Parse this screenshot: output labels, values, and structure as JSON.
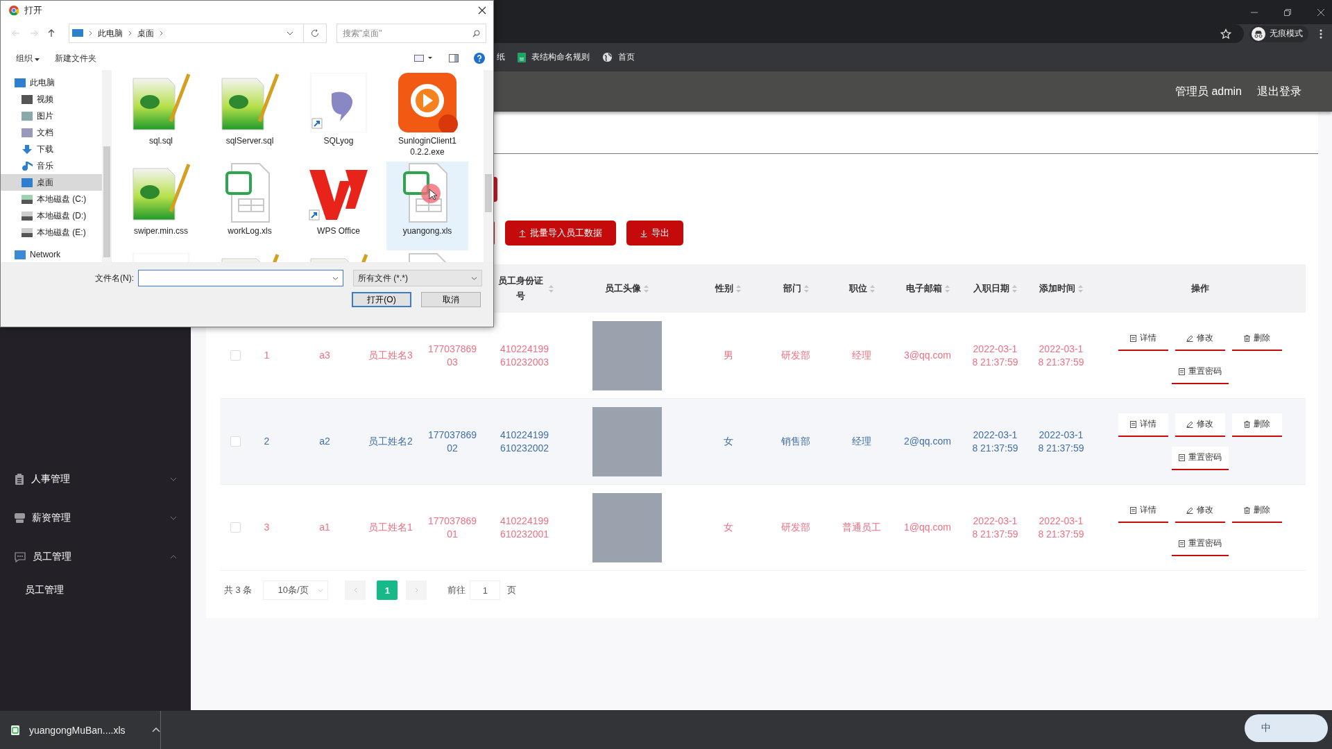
{
  "browser": {
    "bookmarks": [
      {
        "label": "纸",
        "kind": "plain"
      },
      {
        "label": "表结构命名规则",
        "kind": "sheet"
      },
      {
        "label": "首页",
        "kind": "globe"
      }
    ],
    "incognito": "无痕模式"
  },
  "header": {
    "user": "管理员 admin",
    "logout": "退出登录"
  },
  "sidebar": {
    "items": [
      {
        "label": "人事管理",
        "kind": "clipboard",
        "expanded": false
      },
      {
        "label": "薪资管理",
        "kind": "wallet",
        "expanded": false
      },
      {
        "label": "员工管理",
        "kind": "chat",
        "expanded": true,
        "children": [
          {
            "label": "员工管理"
          }
        ]
      }
    ]
  },
  "toolbar": {
    "buttons": [
      {
        "label": "批量导入员工数据",
        "kind": "upload"
      },
      {
        "label": "导出",
        "kind": "download"
      }
    ]
  },
  "table": {
    "columns": [
      {
        "label": "员工身份证号",
        "sortable": true
      },
      {
        "label": "员工头像",
        "sortable": true
      },
      {
        "label": "性别",
        "sortable": true
      },
      {
        "label": "部门",
        "sortable": true
      },
      {
        "label": "职位",
        "sortable": true
      },
      {
        "label": "电子邮箱",
        "sortable": true
      },
      {
        "label": "入职日期",
        "sortable": true
      },
      {
        "label": "添加时间",
        "sortable": true
      },
      {
        "label": "操作",
        "sortable": false
      }
    ],
    "rows": [
      {
        "checked": false,
        "highlighted": false,
        "index": "1",
        "account": "a3",
        "name": "员工姓名3",
        "phone": "17703786903",
        "id_number": "410224199610232003",
        "gender": "男",
        "department": "研发部",
        "position": "经理",
        "email": "3@qq.com",
        "hire_date": "2022-03-18 21:37:59",
        "added_at": "2022-03-18 21:37:59",
        "actions": [
          {
            "label": "详情",
            "kind": "detail"
          },
          {
            "label": "修改",
            "kind": "edit"
          },
          {
            "label": "删除",
            "kind": "delete"
          },
          {
            "label": "重置密码",
            "kind": "reset"
          }
        ]
      },
      {
        "checked": false,
        "highlighted": true,
        "index": "2",
        "account": "a2",
        "name": "员工姓名2",
        "phone": "17703786902",
        "id_number": "410224199610232002",
        "gender": "女",
        "department": "销售部",
        "position": "经理",
        "email": "2@qq.com",
        "hire_date": "2022-03-18 21:37:59",
        "added_at": "2022-03-18 21:37:59",
        "actions": [
          {
            "label": "详情",
            "kind": "detail"
          },
          {
            "label": "修改",
            "kind": "edit"
          },
          {
            "label": "删除",
            "kind": "delete"
          },
          {
            "label": "重置密码",
            "kind": "reset"
          }
        ]
      },
      {
        "checked": false,
        "highlighted": false,
        "index": "3",
        "account": "a1",
        "name": "员工姓名1",
        "phone": "17703786901",
        "id_number": "410224199610232001",
        "gender": "女",
        "department": "研发部",
        "position": "普通员工",
        "email": "1@qq.com",
        "hire_date": "2022-03-18 21:37:59",
        "added_at": "2022-03-18 21:37:59",
        "actions": [
          {
            "label": "详情",
            "kind": "detail"
          },
          {
            "label": "修改",
            "kind": "edit"
          },
          {
            "label": "删除",
            "kind": "delete"
          },
          {
            "label": "重置密码",
            "kind": "reset"
          }
        ]
      }
    ]
  },
  "pagination": {
    "total": "共 3 条",
    "page_size": "10条/页",
    "pages": [
      {
        "label": "1",
        "selected": true
      }
    ],
    "goto_label": "前往",
    "goto_value": "1",
    "goto_suffix": "页"
  },
  "downloads": {
    "file": "yuangongMuBan....xls"
  },
  "ime": {
    "label": "中"
  },
  "dialog": {
    "title": "打开",
    "path": [
      "此电脑",
      "桌面"
    ],
    "search_placeholder": "搜索\"桌面\"",
    "organize": "组织",
    "new_folder": "新建文件夹",
    "tree": [
      {
        "label": "此电脑",
        "kind": "pc",
        "selected": false,
        "children": [
          {
            "label": "视频",
            "kind": "video",
            "selected": false
          },
          {
            "label": "图片",
            "kind": "picture",
            "selected": false
          },
          {
            "label": "文档",
            "kind": "document",
            "selected": false
          },
          {
            "label": "下载",
            "kind": "download",
            "selected": false
          },
          {
            "label": "音乐",
            "kind": "music",
            "selected": false
          },
          {
            "label": "桌面",
            "kind": "desktop",
            "selected": true
          },
          {
            "label": "本地磁盘 (C:)",
            "kind": "system-drive",
            "selected": false
          },
          {
            "label": "本地磁盘 (D:)",
            "kind": "drive",
            "selected": false
          },
          {
            "label": "本地磁盘 (E:)",
            "kind": "drive",
            "selected": false
          }
        ]
      },
      {
        "label": "Network",
        "kind": "network",
        "selected": false
      }
    ],
    "files": [
      {
        "name": "sql.sql",
        "kind": "notepad",
        "selected": false
      },
      {
        "name": "sqlServer.sql",
        "kind": "notepad",
        "selected": false
      },
      {
        "name": "SQLyog",
        "kind": "dolphin",
        "selected": false
      },
      {
        "name": "SunloginClient10.2.2.exe",
        "kind": "sunlogin",
        "selected": false
      },
      {
        "name": "swiper.min.css",
        "kind": "notepad",
        "selected": false
      },
      {
        "name": "workLog.xls",
        "kind": "sheet",
        "selected": false
      },
      {
        "name": "WPS Office",
        "kind": "wps",
        "selected": false
      },
      {
        "name": "yuangong.xls",
        "kind": "sheet",
        "selected": true
      },
      {
        "kind": "red-app",
        "selected": false
      },
      {
        "kind": "notepad",
        "selected": false
      },
      {
        "kind": "notepad",
        "selected": false
      },
      {
        "kind": "blue-doc",
        "selected": false
      }
    ],
    "filename_label": "文件名(N):",
    "filetype": "所有文件 (*.*)",
    "open": "打开(O)",
    "cancel": "取消"
  }
}
